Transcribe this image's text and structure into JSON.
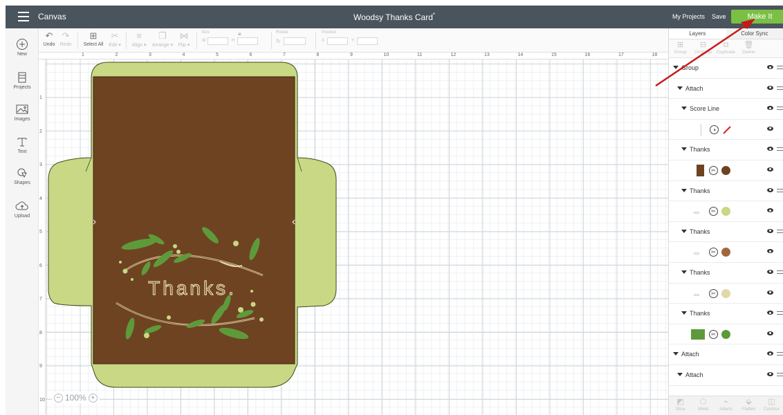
{
  "topbar": {
    "app_title": "Canvas",
    "doc_title": "Woodsy Thanks Card",
    "doc_title_marker": "*",
    "my_projects": "My Projects",
    "save": "Save",
    "make_it": "Make It",
    "make_it_color": "#79c043"
  },
  "toolbar": {
    "undo": "Undo",
    "redo": "Redo",
    "select_all": "Select All",
    "edit": "Edit ▾",
    "align": "Align ▾",
    "arrange": "Arrange ▾",
    "flip": "Flip ▾",
    "size_label": "Size",
    "w": "W",
    "h": "H",
    "rotate_label": "Rotate",
    "position_label": "Position",
    "x": "X",
    "y": "Y"
  },
  "leftnav": {
    "new": "New",
    "projects": "Projects",
    "images": "Images",
    "text": "Text",
    "shapes": "Shapes",
    "upload": "Upload"
  },
  "ruler": {
    "top": [
      "1",
      "2",
      "3",
      "4",
      "5",
      "6",
      "7",
      "8",
      "9",
      "10",
      "11",
      "12",
      "13",
      "14",
      "15",
      "16",
      "17",
      "18"
    ],
    "left": [
      "1",
      "2",
      "3",
      "4",
      "5",
      "6",
      "7",
      "8",
      "9",
      "10"
    ]
  },
  "canvas": {
    "card_text": "Thanks.",
    "zoom": "100%",
    "zoom_minus": "−",
    "zoom_plus": "+",
    "colors": {
      "brown": "#6e4322",
      "light_green": "#c8d884",
      "leaf_green": "#5f9a3a",
      "cream": "#e3d7a8"
    }
  },
  "rightpanel": {
    "tab_layers": "Layers",
    "tab_color_sync": "Color Sync",
    "tools": [
      "Group",
      "Ungroup",
      "Duplicate",
      "Delete"
    ],
    "layers": [
      {
        "label": "Group"
      },
      {
        "label": "Attach"
      },
      {
        "label": "Score Line"
      },
      {
        "label": "Thanks"
      },
      {
        "label": "Thanks"
      },
      {
        "label": "Thanks"
      },
      {
        "label": "Thanks"
      },
      {
        "label": "Thanks"
      },
      {
        "label": "Attach"
      },
      {
        "label": "Attach"
      }
    ],
    "swatch_colors": [
      "#6e4322",
      "#c8d884",
      "#a0673e",
      "#e3d7a8",
      "#5f9a3a"
    ],
    "score_line_color": "#e02020",
    "bottom_tools": [
      "Slice",
      "Weld",
      "Attach",
      "Flatten",
      "Contour"
    ]
  }
}
